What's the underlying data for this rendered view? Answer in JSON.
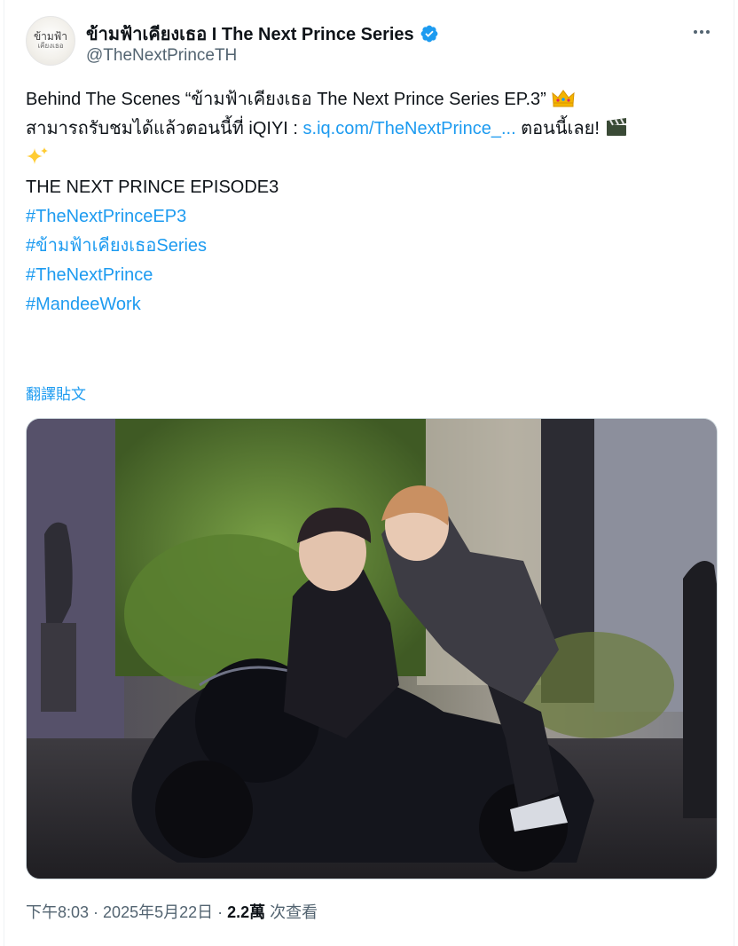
{
  "author": {
    "name": "ข้ามฟ้าเคียงเธอ I The Next Prince Series",
    "handle": "@TheNextPrinceTH",
    "avatar_text_line1": "ข้ามฟ้า",
    "avatar_text_line2": "เคียงเธอ"
  },
  "tweet": {
    "line1": "Behind The Scenes “ข้ามฟ้าเคียงเธอ The Next Prince Series EP.3”",
    "line2_text": "สามารถรับชมได้แล้วตอนนี้ที่ iQIYI : ",
    "line2_link": "s.iq.com/TheNextPrince_...",
    "line2_after": " ตอนนี้เลย!",
    "line4": "THE NEXT PRINCE EPISODE3",
    "hashtags": [
      "#TheNextPrinceEP3",
      "#ข้ามฟ้าเคียงเธอSeries",
      "#TheNextPrince",
      "#MandeeWork"
    ]
  },
  "translate_label": "翻譯貼文",
  "meta": {
    "time": "下午8:03",
    "date": "2025年5月22日",
    "views_count": "2.2萬",
    "views_label": "次查看",
    "separator": " · "
  },
  "icons": {
    "verified": "verified-badge-icon",
    "crown": "crown-emoji-icon",
    "clapper": "clapper-board-emoji-icon",
    "sparkles": "sparkles-emoji-icon",
    "more": "more-options-icon"
  },
  "colors": {
    "link": "#1d9bf0",
    "secondary_text": "#536471",
    "primary_text": "#0f1419"
  }
}
